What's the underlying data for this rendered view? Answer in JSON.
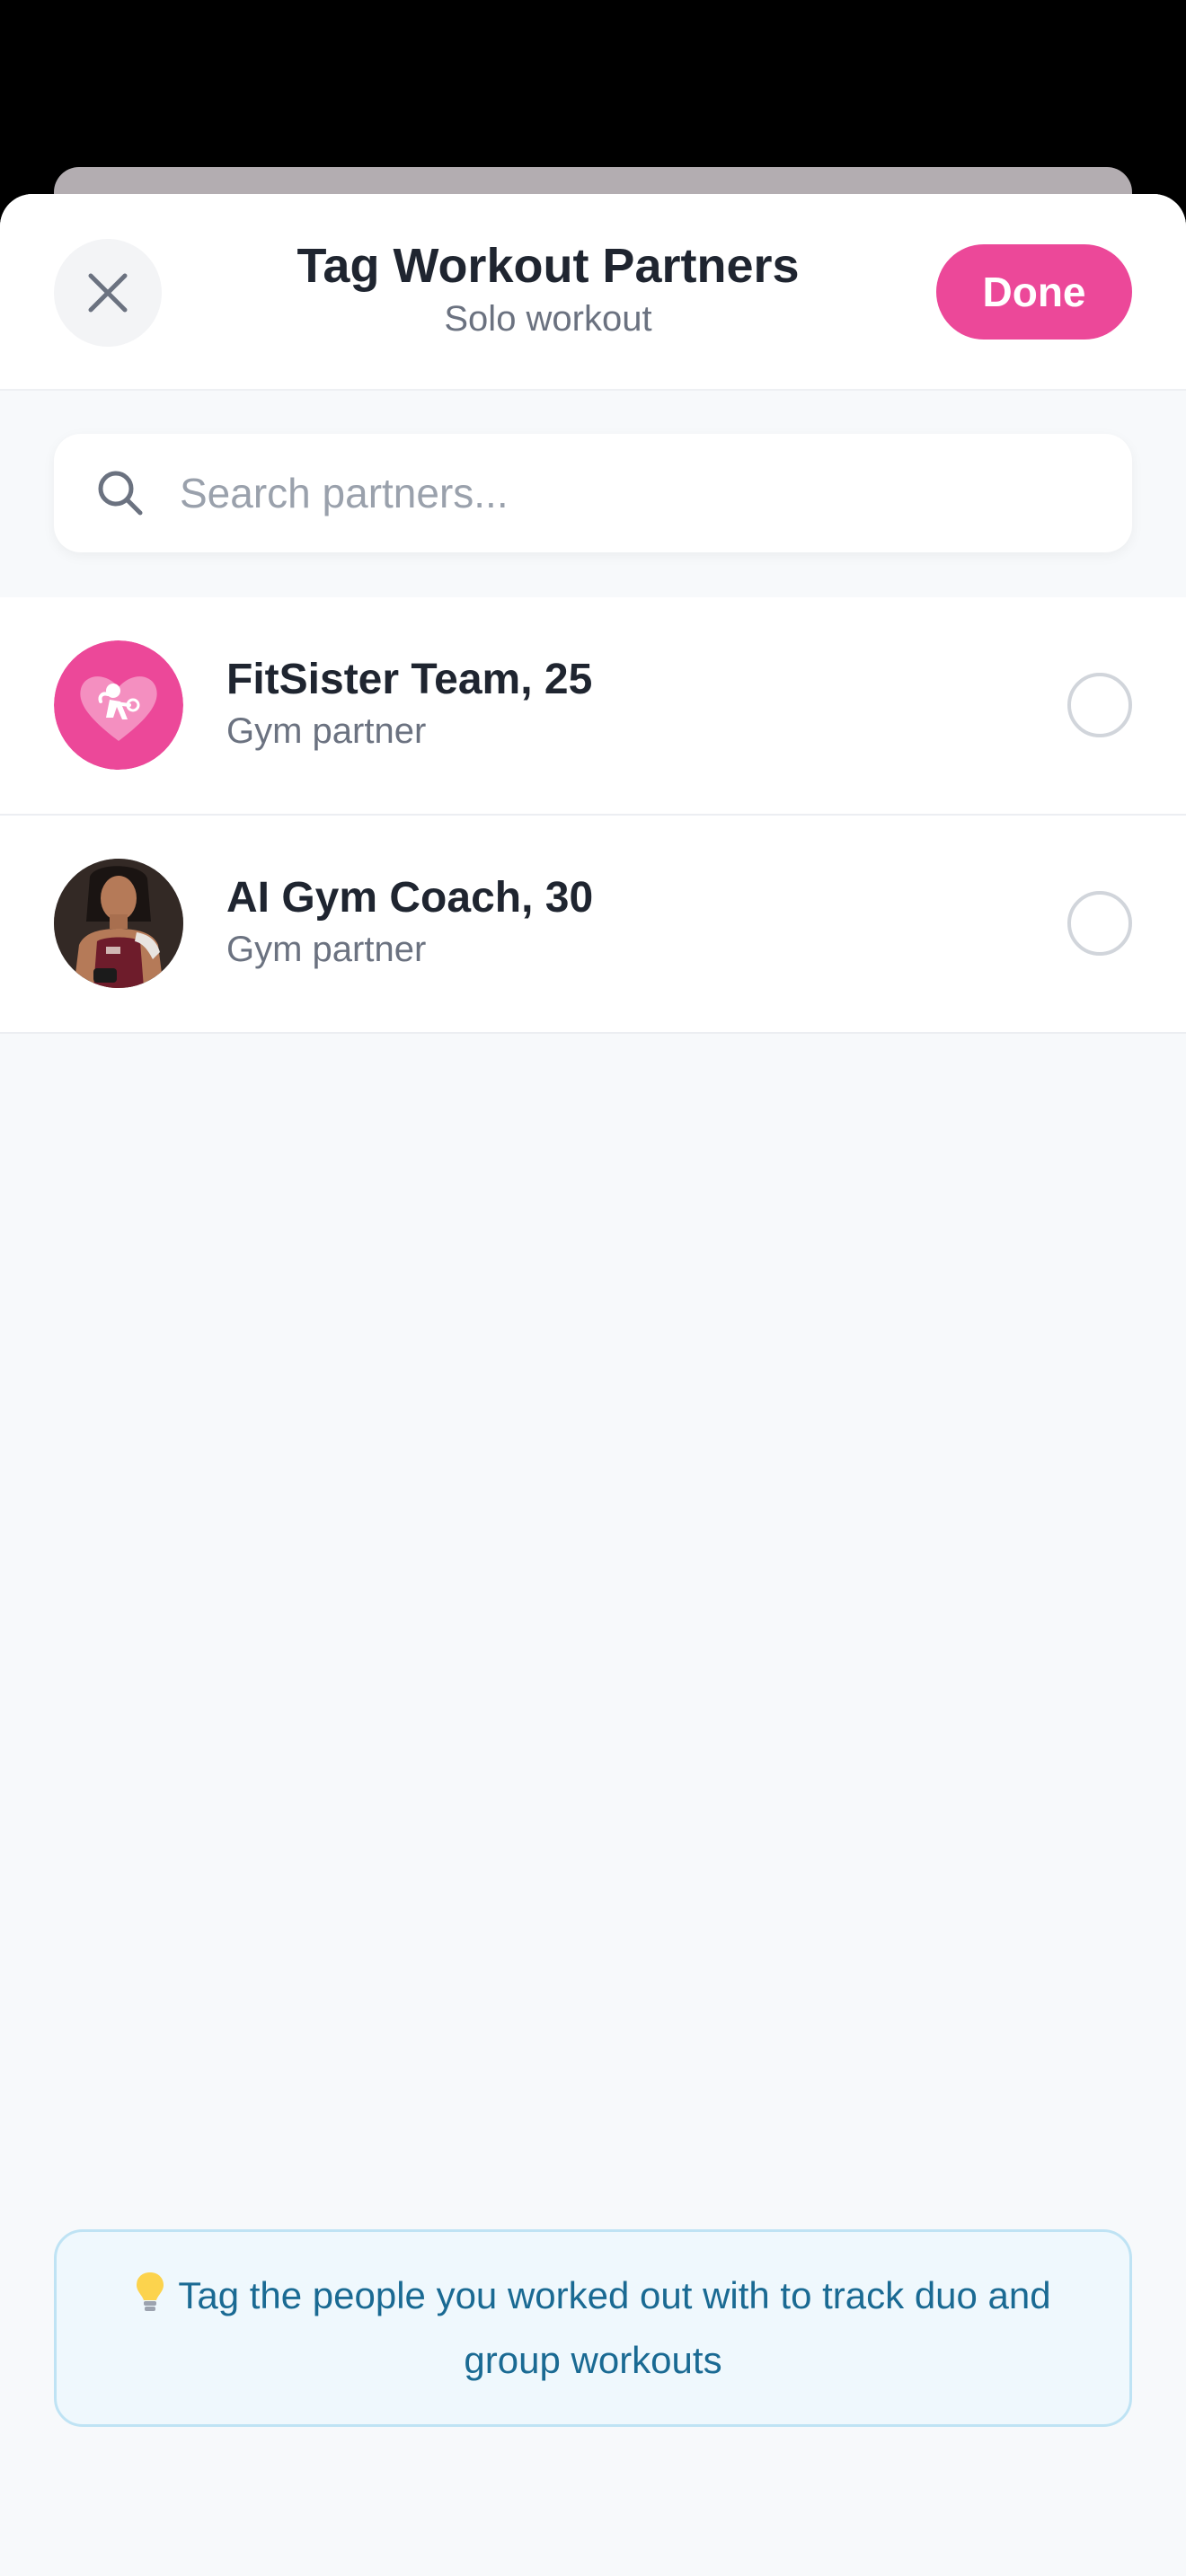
{
  "header": {
    "title": "Tag Workout Partners",
    "subtitle": "Solo workout",
    "done_label": "Done",
    "close_icon": "close-icon"
  },
  "search": {
    "placeholder": "Search partners...",
    "icon": "search-icon"
  },
  "partners": [
    {
      "name": "FitSister Team, 25",
      "role": "Gym partner",
      "selected": false,
      "avatar": "fitsister-logo"
    },
    {
      "name": "AI Gym Coach, 30",
      "role": "Gym partner",
      "selected": false,
      "avatar": "coach-photo"
    }
  ],
  "tip": {
    "icon": "lightbulb-icon",
    "text": "Tag the people you worked out with to track duo and group workouts"
  },
  "colors": {
    "accent": "#ec4899",
    "tip_text": "#1a6a93",
    "tip_bg": "#eff8fd"
  }
}
